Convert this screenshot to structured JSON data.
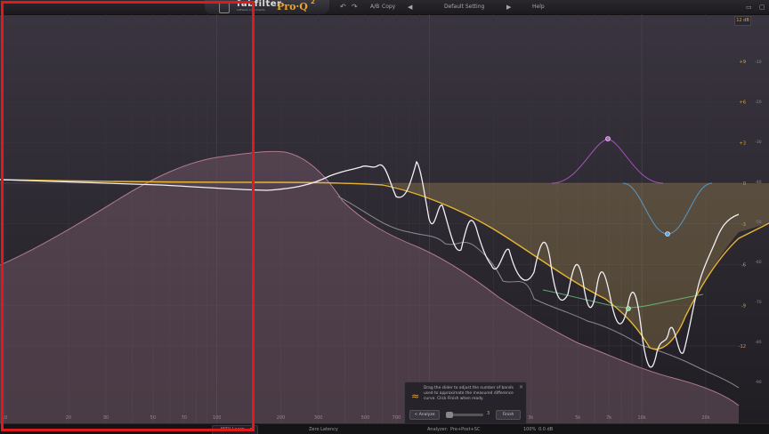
{
  "header": {
    "brand": "fabfilter",
    "brand_sub": "software instruments",
    "product": "Pro·Q",
    "product_sup": "2",
    "undo_icon": "undo-icon",
    "redo_icon": "redo-icon",
    "ab_label": "A/B",
    "copy_label": "Copy",
    "preset_name": "Default Setting",
    "help_label": "Help"
  },
  "graph": {
    "gain_range_badge": "12 dB",
    "db_scale": [
      "+9",
      "+6",
      "+3",
      "0",
      "-3",
      "-6",
      "-9",
      "-12"
    ],
    "db_scale_right": [
      "-10",
      "-20",
      "-30",
      "-40",
      "-50",
      "-60",
      "-70",
      "-80",
      "-90"
    ],
    "freq_labels": [
      "10",
      "20",
      "30",
      "50",
      "70",
      "100",
      "200",
      "300",
      "500",
      "700",
      "1k",
      "2k",
      "3k",
      "5k",
      "7k",
      "10k",
      "20k"
    ],
    "colors": {
      "eq_curve": "#e6b531",
      "analyzer_white": "#f2f0f4",
      "analyzer_fill": "#6e5362",
      "band1": "#c45de0",
      "band2": "#5aaae6",
      "band3": "#7adc8a",
      "highlight_box": "#e0191c"
    }
  },
  "tooltip": {
    "text": "Drag the slider to adjust the number of bands used to approximate the measured difference curve. Click Finish when ready.",
    "analyze_label": "< Analyze",
    "band_count": "3",
    "finish_label": "Finish",
    "close_icon": "close-icon"
  },
  "bottombar": {
    "midi_learn": "MIDI Learn",
    "latency": "Zero Latency",
    "analyzer_label": "Analyzer:",
    "analyzer_value": "Pre+Post+SC",
    "zoom": "100%",
    "output_gain": "0.0 dB"
  }
}
